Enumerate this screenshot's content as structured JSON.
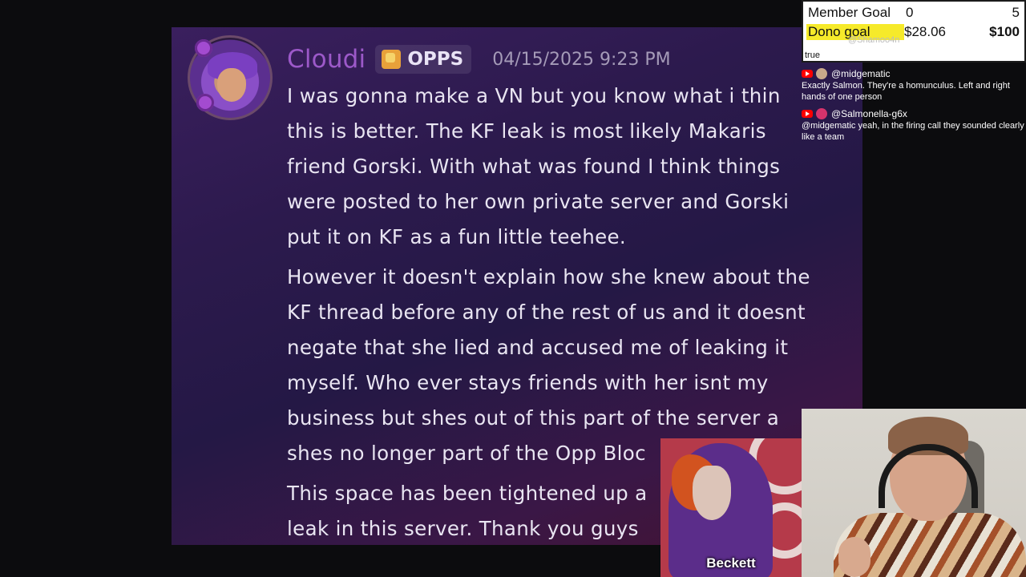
{
  "message": {
    "username": "Cloudi",
    "role_label": "OPPS",
    "timestamp": "04/15/2025 9:23 PM",
    "paragraphs": [
      [
        "I was gonna make a VN but you know what i thin",
        "this is better. The KF leak is most likely Makaris",
        "friend Gorski. With what was found I think things",
        "were posted to her own private server and Gorski",
        "put it on KF as a fun little teehee."
      ],
      [
        "However it doesn't explain how she knew about the",
        "KF thread before any of the rest of us and it doesnt",
        "negate that she lied and accused me of leaking it",
        "myself. Who ever stays friends with her isnt my",
        "business but shes out of this part of the server a",
        "shes no longer part of the Opp Bloc"
      ],
      [
        "This space has been tightened up a",
        "leak in this server. Thank you guys"
      ]
    ]
  },
  "goals": {
    "member": {
      "label": "Member Goal",
      "current": "0",
      "target": "5"
    },
    "dono": {
      "label": "Dono goal",
      "current": "$28.06",
      "target": "$100"
    },
    "ghost_name": "@Shamoo4n",
    "ghost_text": "true"
  },
  "chat": [
    {
      "name": "@midgematic",
      "avatar_color": "#c9a98a",
      "text": "Exactly Salmon. They're a homunculus. Left and right hands of one person"
    },
    {
      "name": "@Salmonella-g6x",
      "avatar_color": "#d6336c",
      "text": "@midgematic yeah, in the firing call they sounded clearly like a team"
    }
  ],
  "overlay": {
    "character_name": "Beckett"
  },
  "colors": {
    "username": "#9c59c9",
    "dono_highlight": "#f6ea2a",
    "youtube_red": "#ff0000"
  }
}
